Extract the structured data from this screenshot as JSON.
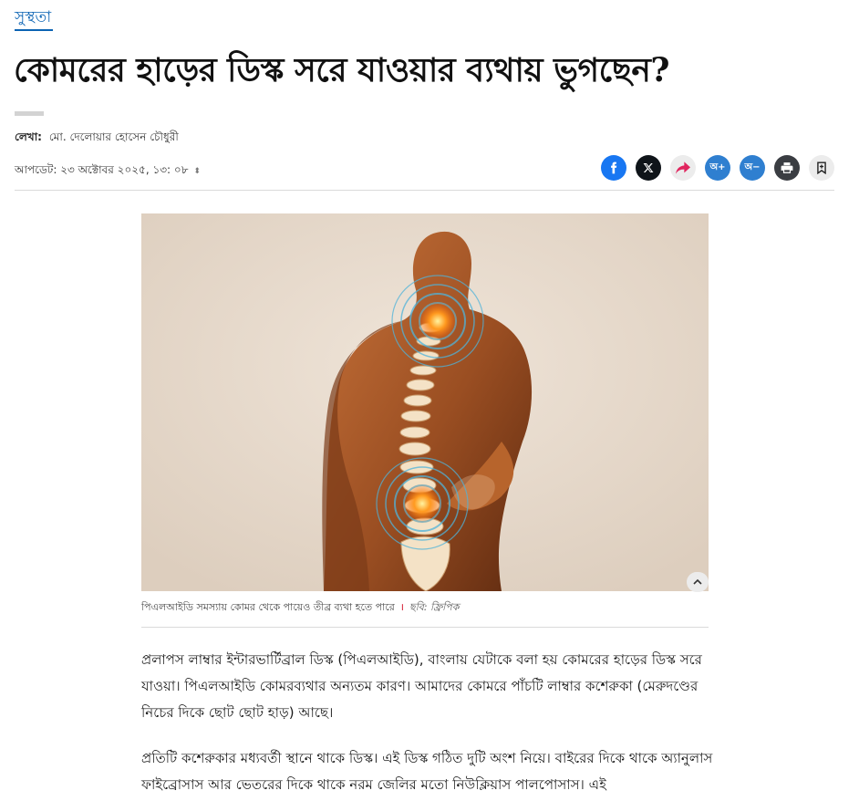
{
  "section": {
    "label": "সুস্থতা"
  },
  "headline": "কোমরের হাড়ের ডিস্ক সরে যাওয়ার ব্যথায় ভুগছেন?",
  "byline": {
    "label": "লেখা:",
    "author": "মো. দেলোয়ার হোসেন চৌধুরী"
  },
  "updated": {
    "text": "আপডেট: ২৩ অক্টোবর ২০২৫, ১৩: ০৮",
    "icon": "sort-toggle-icon"
  },
  "actions": {
    "font_plus": "অ+",
    "font_minus": "অ−",
    "icons": [
      "facebook-icon",
      "x-icon",
      "share-icon",
      "font-increase-icon",
      "font-decrease-icon",
      "print-icon",
      "bookmark-icon"
    ],
    "colors": {
      "facebook": "#1877f2",
      "x": "#0f1419",
      "font": "#2f7fd0",
      "print": "#3a3d42",
      "share_arrow": "#e0245e"
    }
  },
  "figure": {
    "caption": "পিএলআইডি সমস্যায় কোমর থেকে পায়েও তীব্র ব্যথা হতে পারে",
    "separator": "।",
    "credit": "ছবি: ফ্রিপিক"
  },
  "article": {
    "paragraphs": [
      "প্রলাপস লাম্বার ইন্টারভার্টিব্রাল ডিস্ক (পিএলআইডি), বাংলায় যেটাকে বলা হয় কোমরের হাড়ের ডিস্ক সরে যাওয়া। পিএলআইডি কোমরব্যথার অন্যতম কারণ। আমাদের কোমরে পাঁচটি লাম্বার কশেরুকা (মেরুদণ্ডের নিচের দিকে ছোট ছোট হাড়) আছে।",
      "প্রতিটি কশেরুকার মধ্যবর্তী স্থানে থাকে ডিস্ক। এই ডিস্ক গঠিত দুটি অংশ নিয়ে। বাইরের দিকে থাকে অ্যানুলাস ফাইব্রোসাস আর ভেতরের দিকে থাকে নরম জেলির মতো নিউক্লিয়াস পালপোসাস। এই"
    ]
  }
}
